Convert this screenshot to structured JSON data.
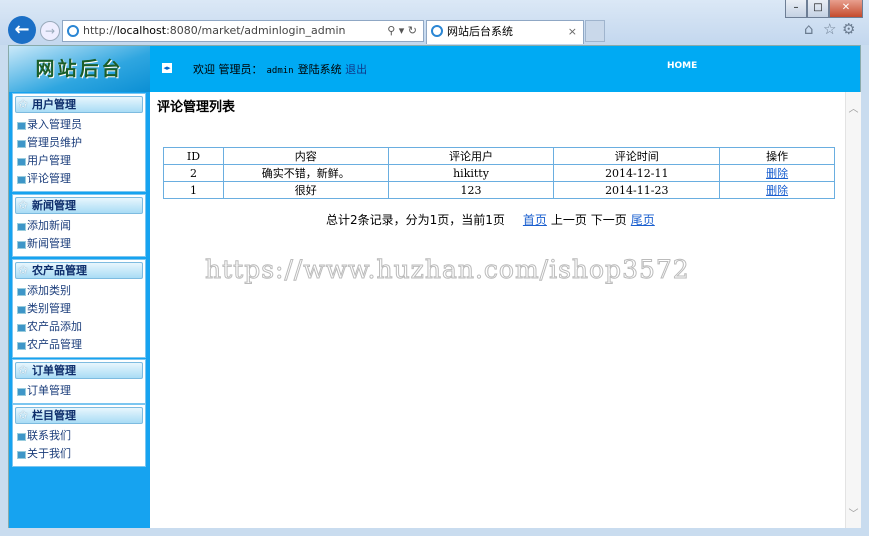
{
  "browser": {
    "url_prefix": "http://",
    "url_host": "localhost",
    "url_rest": ":8080/market/adminlogin_admin",
    "tab_title": "网站后台系统",
    "tab_close": "×",
    "minimize": "–",
    "maximize": "□",
    "close": "✕"
  },
  "header": {
    "logo": "网站后台",
    "welcome": "欢迎 管理员：",
    "admin": "admin",
    "login_status": "登陆系统",
    "logout": "退出",
    "home": "HOME"
  },
  "sidebar": [
    {
      "title": "用户管理",
      "items": [
        "录入管理员",
        "管理员维护",
        "用户管理",
        "评论管理"
      ]
    },
    {
      "title": "新闻管理",
      "items": [
        "添加新闻",
        "新闻管理"
      ]
    },
    {
      "title": "农产品管理",
      "items": [
        "添加类别",
        "类别管理",
        "农产品添加",
        "农产品管理"
      ]
    },
    {
      "title": "订单管理",
      "items": [
        "订单管理"
      ]
    },
    {
      "title": "栏目管理",
      "items": [
        "联系我们",
        "关于我们"
      ]
    }
  ],
  "main": {
    "title": "评论管理列表",
    "columns": [
      "ID",
      "内容",
      "评论用户",
      "评论时间",
      "操作"
    ],
    "rows": [
      {
        "id": "2",
        "content": "确实不错，新鲜。",
        "user": "hikitty",
        "time": "2014-12-11",
        "action": "删除"
      },
      {
        "id": "1",
        "content": "很好",
        "user": "123",
        "time": "2014-11-23",
        "action": "删除"
      }
    ],
    "pager": {
      "summary": "总计2条记录，分为1页，当前1页",
      "first": "首页",
      "prev": "上一页",
      "next": "下一页",
      "last": "尾页"
    },
    "watermark": "https://www.huzhan.com/ishop3572"
  }
}
